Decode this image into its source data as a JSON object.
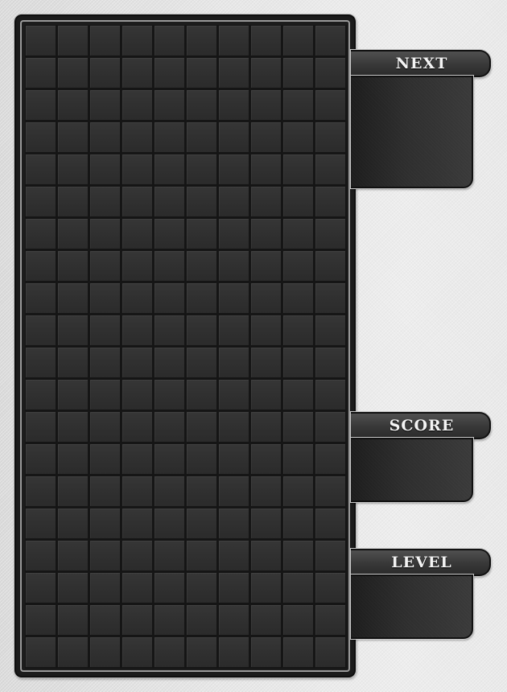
{
  "board": {
    "columns": 10,
    "rows": 20
  },
  "panels": {
    "next": {
      "label": "NEXT",
      "value": ""
    },
    "score": {
      "label": "SCORE",
      "value": ""
    },
    "level": {
      "label": "LEVEL",
      "value": ""
    }
  },
  "colors": {
    "background": "#e6e6e6",
    "board": "#1b1b1b",
    "cell": "#303030",
    "panel": "#2e2e2e",
    "label_text": "#f4f4f4"
  }
}
